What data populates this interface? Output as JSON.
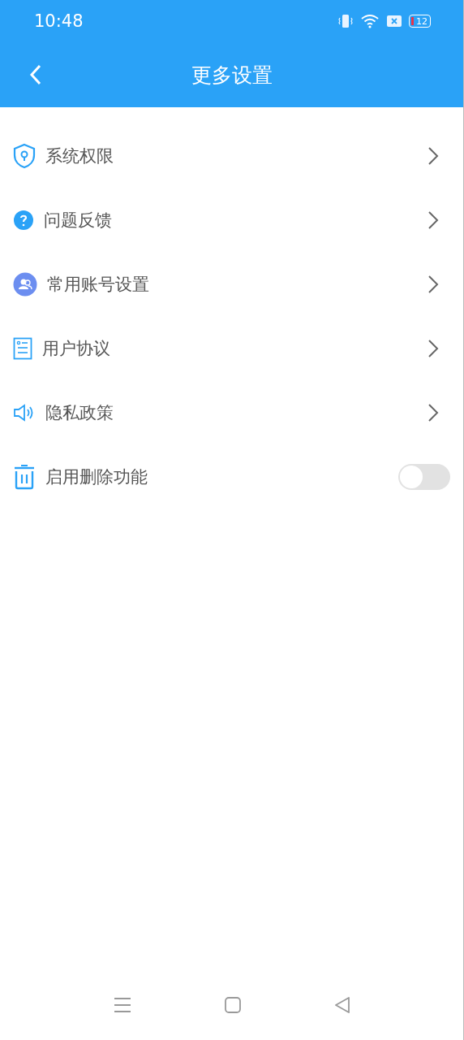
{
  "status_bar": {
    "time": "10:48",
    "battery": "12"
  },
  "header": {
    "title": "更多设置"
  },
  "items": [
    {
      "kind": "link",
      "label": "系统权限"
    },
    {
      "kind": "link",
      "label": "问题反馈"
    },
    {
      "kind": "link",
      "label": "常用账号设置"
    },
    {
      "kind": "link",
      "label": "用户协议"
    },
    {
      "kind": "link",
      "label": "隐私政策"
    },
    {
      "kind": "toggle",
      "label": "启用删除功能",
      "on": false
    }
  ]
}
